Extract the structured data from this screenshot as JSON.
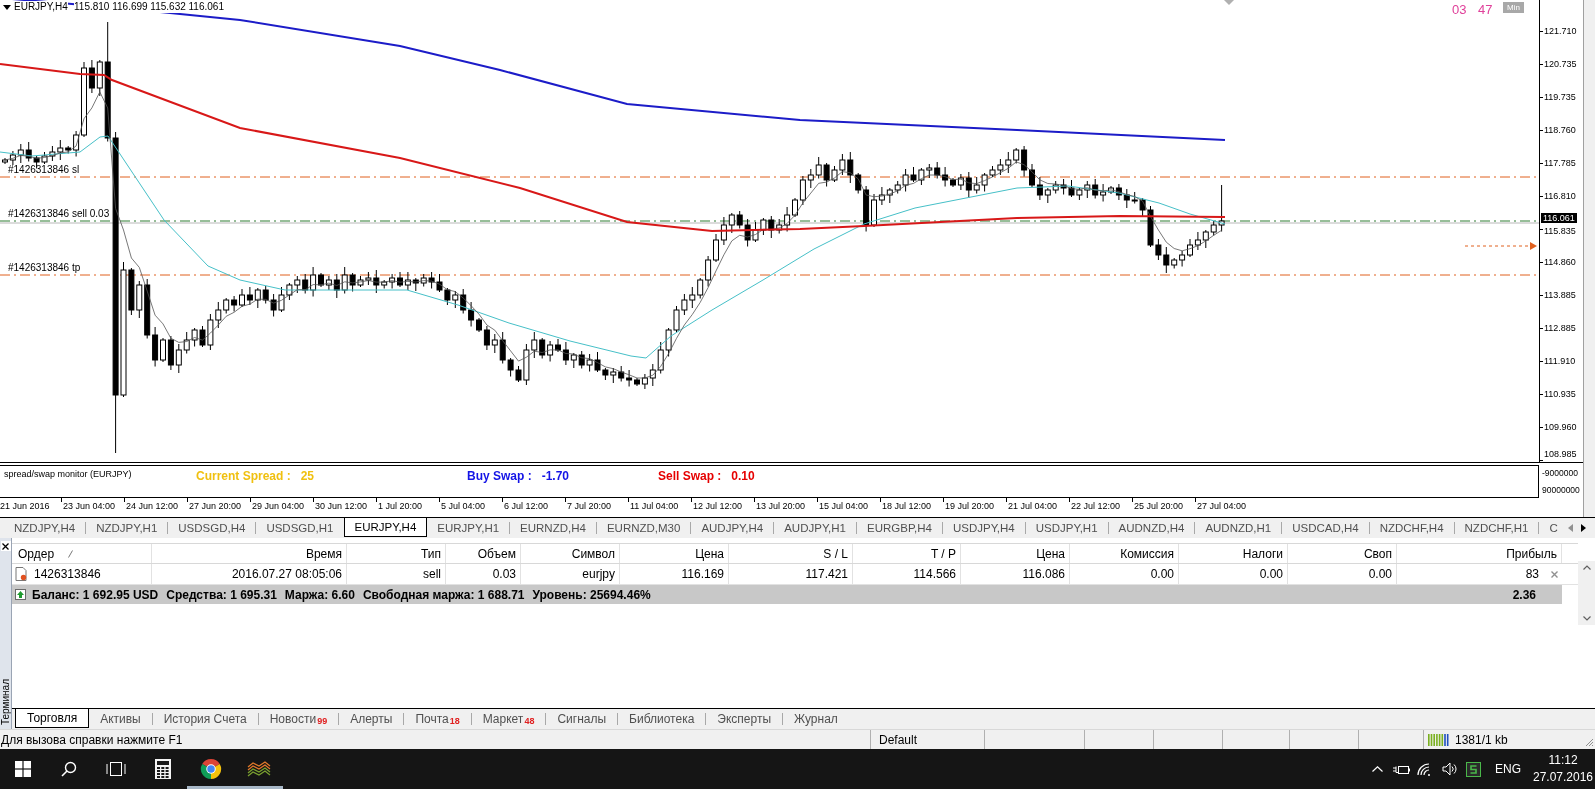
{
  "chart": {
    "symbol": "EURJPY,H4",
    "ohlc": "115.810 116.699 115.632 116.061",
    "countdown": [
      "03",
      "47"
    ],
    "countdown_unit": "Min",
    "order_lines": [
      {
        "kind": "sl",
        "label": "#1426313846 sl"
      },
      {
        "kind": "entry",
        "label": "#1426313846 sell 0.03"
      },
      {
        "kind": "tp",
        "label": "#1426313846 tp"
      }
    ],
    "price_axis": [
      "121.710",
      "120.735",
      "119.735",
      "118.760",
      "117.785",
      "116.810",
      "115.835",
      "114.860",
      "113.885",
      "112.885",
      "111.910",
      "110.935",
      "109.960",
      "108.985"
    ],
    "current_price": "116.061",
    "indicator": {
      "name": "spread/swap monitor (EURJPY)",
      "items": [
        {
          "label": "Current Spread :",
          "value": "25",
          "color": "#f0c010"
        },
        {
          "label": "Buy Swap :",
          "value": "-1.70",
          "color": "#1414e6"
        },
        {
          "label": "Sell Swap :",
          "value": "0.10",
          "color": "#e60000"
        }
      ],
      "axis": [
        "-9000000",
        "90000000"
      ]
    },
    "time_axis": [
      "21 Jun 2016",
      "23 Jun 04:00",
      "24 Jun 12:00",
      "27 Jun 20:00",
      "29 Jun 04:00",
      "30 Jun 12:00",
      "1 Jul 20:00",
      "5 Jul 04:00",
      "6 Jul 12:00",
      "7 Jul 20:00",
      "11 Jul 04:00",
      "12 Jul 12:00",
      "13 Jul 20:00",
      "15 Jul 04:00",
      "18 Jul 12:00",
      "19 Jul 20:00",
      "21 Jul 04:00",
      "22 Jul 12:00",
      "25 Jul 20:00",
      "27 Jul 04:00"
    ]
  },
  "symbol_tabs": [
    {
      "label": "NZDJPY,H4",
      "selected": false
    },
    {
      "label": "NZDJPY,H1",
      "selected": false
    },
    {
      "label": "USDSGD,H4",
      "selected": false
    },
    {
      "label": "USDSGD,H1",
      "selected": false
    },
    {
      "label": "EURJPY,H4",
      "selected": true
    },
    {
      "label": "EURJPY,H1",
      "selected": false
    },
    {
      "label": "EURNZD,H4",
      "selected": false
    },
    {
      "label": "EURNZD,M30",
      "selected": false
    },
    {
      "label": "AUDJPY,H4",
      "selected": false
    },
    {
      "label": "AUDJPY,H1",
      "selected": false
    },
    {
      "label": "EURGBP,H4",
      "selected": false
    },
    {
      "label": "USDJPY,H4",
      "selected": false
    },
    {
      "label": "USDJPY,H1",
      "selected": false
    },
    {
      "label": "AUDNZD,H4",
      "selected": false
    },
    {
      "label": "AUDNZD,H1",
      "selected": false
    },
    {
      "label": "USDCAD,H4",
      "selected": false
    },
    {
      "label": "NZDCHF,H4",
      "selected": false
    },
    {
      "label": "NZDCHF,H1",
      "selected": false
    },
    {
      "label": "C",
      "selected": false
    }
  ],
  "terminal": {
    "title": "Терминал",
    "columns": [
      {
        "label": "Ордер",
        "sorted": true
      },
      {
        "label": "Время",
        "sorted": false
      },
      {
        "label": "Тип",
        "sorted": false
      },
      {
        "label": "Объем",
        "sorted": false
      },
      {
        "label": "Символ",
        "sorted": false
      },
      {
        "label": "Цена",
        "sorted": false
      },
      {
        "label": "S / L",
        "sorted": false
      },
      {
        "label": "T / P",
        "sorted": false
      },
      {
        "label": "Цена",
        "sorted": false
      },
      {
        "label": "Комиссия",
        "sorted": false
      },
      {
        "label": "Налоги",
        "sorted": false
      },
      {
        "label": "Своп",
        "sorted": false
      },
      {
        "label": "Прибыль",
        "sorted": false
      }
    ],
    "rows": [
      {
        "cells": [
          "1426313846",
          "2016.07.27 08:05:06",
          "sell",
          "0.03",
          "eurjpy",
          "116.169",
          "117.421",
          "114.566",
          "116.086",
          "0.00",
          "0.00",
          "0.00",
          "83"
        ]
      }
    ],
    "summary": {
      "items": [
        "Баланс: 1 692.95 USD",
        "Средства: 1 695.31",
        "Маржа: 6.60",
        "Свободная маржа: 1 688.71",
        "Уровень: 25694.46%"
      ],
      "profit": "2.36"
    },
    "tabs": [
      {
        "label": "Торговля",
        "selected": true
      },
      {
        "label": "Активы",
        "selected": false
      },
      {
        "label": "История Счета",
        "selected": false
      },
      {
        "label": "Новости",
        "count": "99",
        "selected": false
      },
      {
        "label": "Алерты",
        "selected": false
      },
      {
        "label": "Почта",
        "count": "18",
        "selected": false
      },
      {
        "label": "Маркет",
        "count": "48",
        "selected": false
      },
      {
        "label": "Сигналы",
        "selected": false
      },
      {
        "label": "Библиотека",
        "selected": false
      },
      {
        "label": "Эксперты",
        "selected": false
      },
      {
        "label": "Журнал",
        "selected": false
      }
    ]
  },
  "status_bar": {
    "help": "Для вызова справки нажмите F1",
    "profile": "Default",
    "traffic": "1381/1 kb"
  },
  "taskbar": {
    "apps": [
      {
        "kind": "calculator",
        "running": false
      },
      {
        "kind": "chrome",
        "running": true
      },
      {
        "kind": "alpari",
        "running": true
      }
    ],
    "language": "ENG",
    "time": "11:12",
    "date": "27.07.2016"
  }
}
